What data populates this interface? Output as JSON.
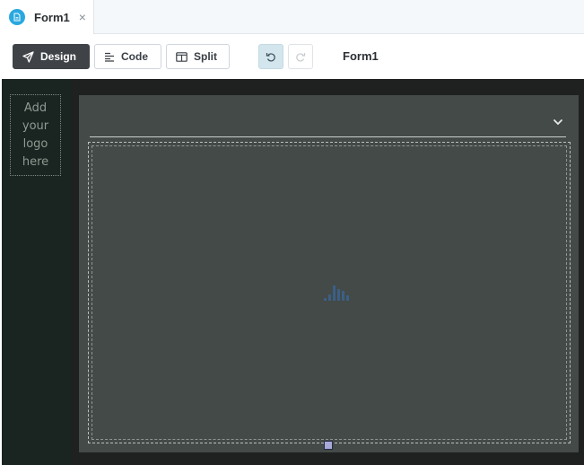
{
  "tabs": [
    {
      "label": "Form1",
      "icon": "document-icon",
      "close_glyph": "×"
    }
  ],
  "toolbar": {
    "design_label": "Design",
    "code_label": "Code",
    "split_label": "Split",
    "title": "Form1"
  },
  "sidebar": {
    "logo_placeholder": "Add\nyour\nlogo\nhere"
  },
  "colors": {
    "tab_icon": "#29a8e0",
    "active_button": "#3f4347",
    "canvas": "#1f2020",
    "form_area": "#434a47",
    "loader": "#3b5f86",
    "resize_handle": "#a7a9d9"
  }
}
